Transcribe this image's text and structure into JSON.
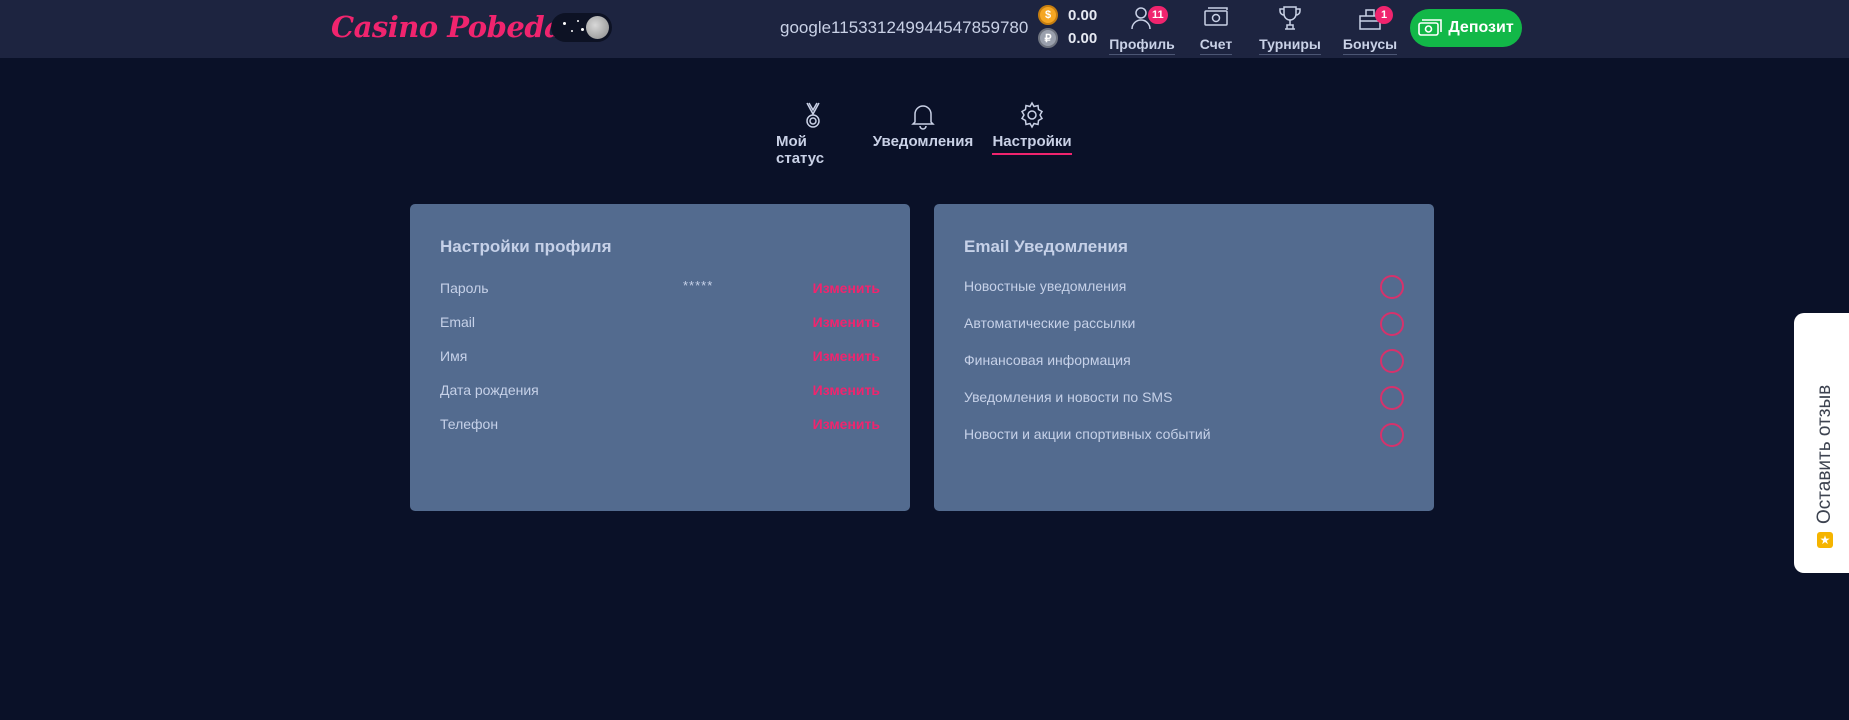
{
  "header": {
    "logo": "Casino Pobeda",
    "username": "google115331249944547859780",
    "balances": [
      {
        "icon": "gold-coin-icon",
        "symbol": "$",
        "value": "0.00"
      },
      {
        "icon": "silver-coin-icon",
        "symbol": "₽",
        "value": "0.00"
      }
    ],
    "nav": [
      {
        "label": "Профиль",
        "icon": "user-icon",
        "badge": "11"
      },
      {
        "label": "Счет",
        "icon": "cash-icon"
      },
      {
        "label": "Турниры",
        "icon": "trophy-icon"
      },
      {
        "label": "Бонусы",
        "icon": "gift-icon",
        "badge": "1"
      }
    ],
    "deposit_label": "Депозит"
  },
  "tabs": [
    {
      "label": "Мой статус",
      "icon": "medal-icon"
    },
    {
      "label": "Уведомления",
      "icon": "bell-icon"
    },
    {
      "label": "Настройки",
      "icon": "gear-icon",
      "active": true
    }
  ],
  "profile_settings": {
    "title": "Настройки профиля",
    "rows": [
      {
        "label": "Пароль",
        "value": "*****",
        "action": "Изменить"
      },
      {
        "label": "Email",
        "value": "",
        "action": "Изменить"
      },
      {
        "label": "Имя",
        "value": "",
        "action": "Изменить"
      },
      {
        "label": "Дата рождения",
        "value": "",
        "action": "Изменить"
      },
      {
        "label": "Телефон",
        "value": "",
        "action": "Изменить"
      }
    ]
  },
  "email_notifications": {
    "title": "Email Уведомления",
    "rows": [
      {
        "label": "Новостные уведомления",
        "checked": false
      },
      {
        "label": "Автоматические рассылки",
        "checked": false
      },
      {
        "label": "Финансовая информация",
        "checked": false
      },
      {
        "label": "Уведомления и новости по SMS",
        "checked": false
      },
      {
        "label": "Новости и акции спортивных событий",
        "checked": false
      }
    ]
  },
  "feedback": {
    "label": "Оставить отзыв",
    "icon": "star-icon"
  },
  "colors": {
    "accent": "#f0246e",
    "deposit": "#12b848",
    "card": "#536b8f",
    "background": "#0a1128"
  }
}
